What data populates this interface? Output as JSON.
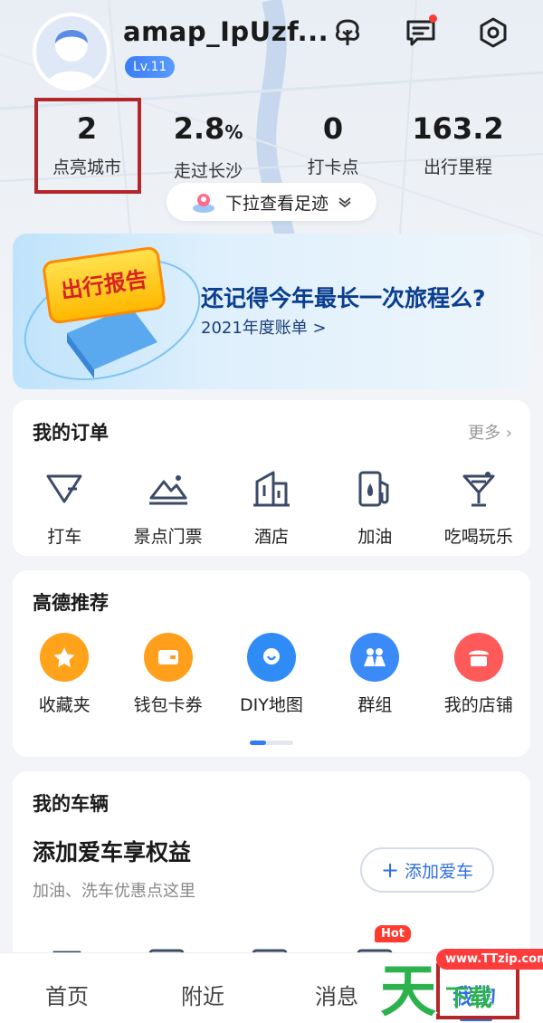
{
  "profile": {
    "username": "amap_IpUzf...",
    "level": "Lv.11"
  },
  "stats": [
    {
      "value": "2",
      "unit": "",
      "label": "点亮城市"
    },
    {
      "value": "2.8",
      "unit": "%",
      "label": "走过长沙"
    },
    {
      "value": "0",
      "unit": "",
      "label": "打卡点"
    },
    {
      "value": "163.2",
      "unit": "",
      "label": "出行里程"
    }
  ],
  "pull_hint": "下拉查看足迹",
  "report": {
    "badge": "出行报告",
    "title": "还记得今年最长一次旅程么?",
    "subtitle": "2021年度账单 >"
  },
  "orders": {
    "title": "我的订单",
    "more": "更多",
    "items": [
      {
        "label": "打车",
        "icon": "taxi-icon"
      },
      {
        "label": "景点门票",
        "icon": "scenic-ticket-icon"
      },
      {
        "label": "酒店",
        "icon": "hotel-icon"
      },
      {
        "label": "加油",
        "icon": "fuel-icon"
      },
      {
        "label": "吃喝玩乐",
        "icon": "cocktail-icon"
      }
    ]
  },
  "recommend": {
    "title": "高德推荐",
    "items": [
      {
        "label": "收藏夹",
        "icon": "star-icon",
        "color": "#ffa31a"
      },
      {
        "label": "钱包卡券",
        "icon": "wallet-icon",
        "color": "#ff9f1c"
      },
      {
        "label": "DIY地图",
        "icon": "map-pin-icon",
        "color": "#2f8cf6"
      },
      {
        "label": "群组",
        "icon": "group-icon",
        "color": "#3a8bf7"
      },
      {
        "label": "我的店铺",
        "icon": "shop-icon",
        "color": "#ff5a5a"
      }
    ]
  },
  "vehicle": {
    "title": "我的车辆",
    "headline": "添加爱车享权益",
    "subtitle": "加油、洗车优惠点这里",
    "add_button": "添加爱车",
    "hot": "Hot"
  },
  "tabs": [
    "首页",
    "附近",
    "消息",
    "我的"
  ],
  "watermark": {
    "big": "天",
    "small": "下载",
    "site": "www.TTzip.com"
  },
  "colors": {
    "accent": "#2f6fe0",
    "highlight": "#b3262a"
  }
}
